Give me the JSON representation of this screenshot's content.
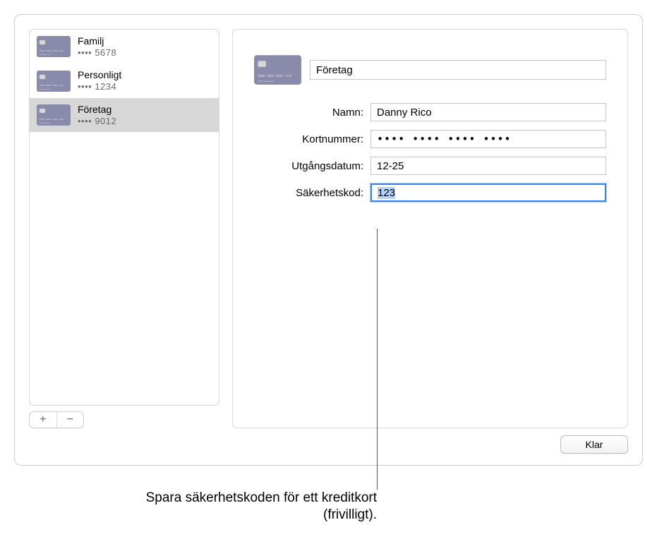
{
  "sidebar": {
    "items": [
      {
        "name": "Familj",
        "last4": "•••• 5678"
      },
      {
        "name": "Personligt",
        "last4": "•••• 1234"
      },
      {
        "name": "Företag",
        "last4": "•••• 9012"
      }
    ],
    "add_label": "+",
    "remove_label": "−"
  },
  "detail": {
    "title_value": "Företag",
    "rows": {
      "name": {
        "label": "Namn:",
        "value": "Danny Rico"
      },
      "number": {
        "label": "Kortnummer:",
        "mask": "•••• •••• •••• ••••"
      },
      "expiry": {
        "label": "Utgångsdatum:",
        "value": "12-25"
      },
      "cvc": {
        "label": "Säkerhetskod:",
        "value": "123"
      }
    }
  },
  "footer": {
    "done_label": "Klar"
  },
  "callout": {
    "text": "Spara säkerhetskoden för ett kreditkort (frivilligt)."
  }
}
